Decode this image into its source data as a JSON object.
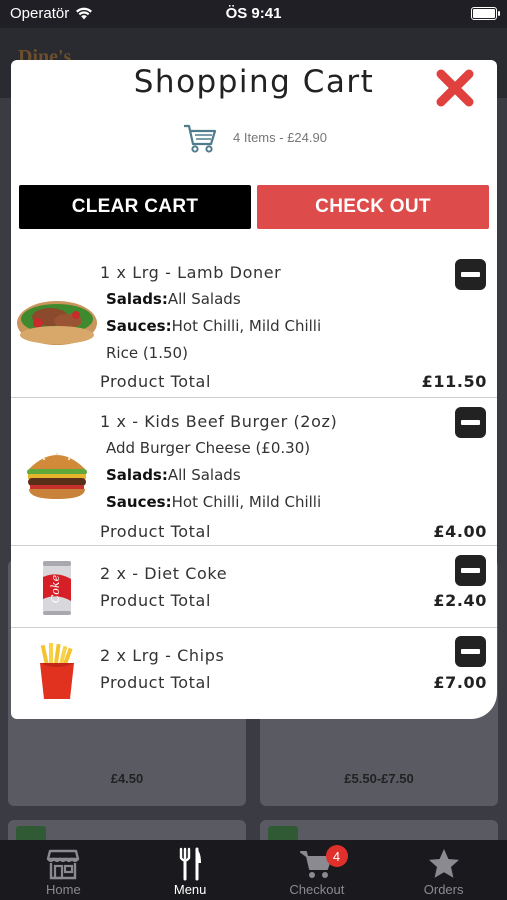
{
  "status_bar": {
    "carrier": "Operatör",
    "time": "ÖS 9:41"
  },
  "background": {
    "brand": "Dine's",
    "prices": [
      "£4.50",
      "£5.50-£7.50"
    ]
  },
  "modal": {
    "title": "Shopping Cart",
    "summary": "4 Items - £24.90",
    "clear_label": "CLEAR CART",
    "checkout_label": "CHECK OUT"
  },
  "items": [
    {
      "title": "1 x Lrg - Lamb Doner",
      "image": "doner-kebab",
      "lines": [
        {
          "label": "Salads:",
          "text": "All Salads"
        },
        {
          "label": "Sauces:",
          "text": "Hot Chilli, Mild Chilli"
        },
        {
          "label": "",
          "text": "Rice (1.50)"
        }
      ],
      "total_label": "Product Total",
      "total": "£11.50"
    },
    {
      "title": "1 x - Kids Beef Burger (2oz)",
      "image": "burger",
      "lines": [
        {
          "label": "",
          "text": "Add Burger Cheese (£0.30)"
        },
        {
          "label": "Salads:",
          "text": "All Salads"
        },
        {
          "label": "Sauces:",
          "text": "Hot Chilli, Mild Chilli"
        }
      ],
      "total_label": "Product Total",
      "total": "£4.00"
    },
    {
      "title": "2 x - Diet Coke",
      "image": "coke-can",
      "lines": [],
      "total_label": "Product Total",
      "total": "£2.40"
    },
    {
      "title": "2 x Lrg - Chips",
      "image": "chips",
      "lines": [],
      "total_label": "Product Total",
      "total": "£7.00"
    }
  ],
  "tabbar": {
    "tabs": [
      {
        "label": "Home",
        "icon": "store-icon"
      },
      {
        "label": "Menu",
        "icon": "cutlery-icon"
      },
      {
        "label": "Checkout",
        "icon": "cart-icon",
        "badge": "4"
      },
      {
        "label": "Orders",
        "icon": "star-icon"
      }
    ],
    "active": "Menu"
  },
  "colors": {
    "accent": "#dd4b4a",
    "close": "#e0413f",
    "tab_active": "#ffffff",
    "tab_inactive": "#8a8a90"
  }
}
